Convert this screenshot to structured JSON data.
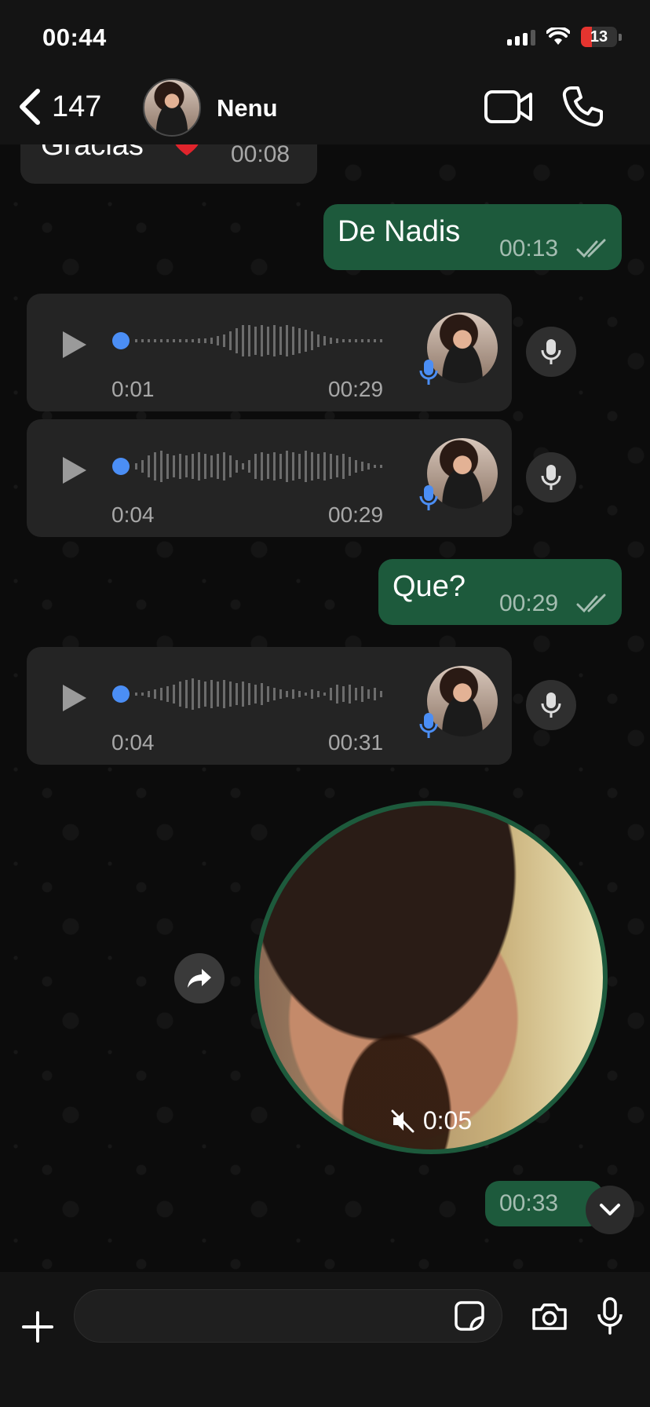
{
  "status_bar": {
    "time": "00:44",
    "battery": "13"
  },
  "header": {
    "back_count": "147",
    "contact_name": "Nenu"
  },
  "messages": {
    "m1": {
      "text": "Gracias",
      "time": "00:08"
    },
    "m2": {
      "text": "De Nadis",
      "time": "00:13"
    },
    "v1": {
      "current": "0:01",
      "duration": "00:29"
    },
    "v2": {
      "current": "0:04",
      "duration": "00:29"
    },
    "m3": {
      "text": "Que?",
      "time": "00:29"
    },
    "v3": {
      "current": "0:04",
      "duration": "00:31"
    },
    "video": {
      "duration": "0:05",
      "time": "00:33"
    }
  },
  "composer": {
    "placeholder": ""
  },
  "colors": {
    "outgoing_bubble": "#1d5a3c",
    "incoming_bubble": "#242424",
    "accent_blue": "#4b8ef5"
  }
}
